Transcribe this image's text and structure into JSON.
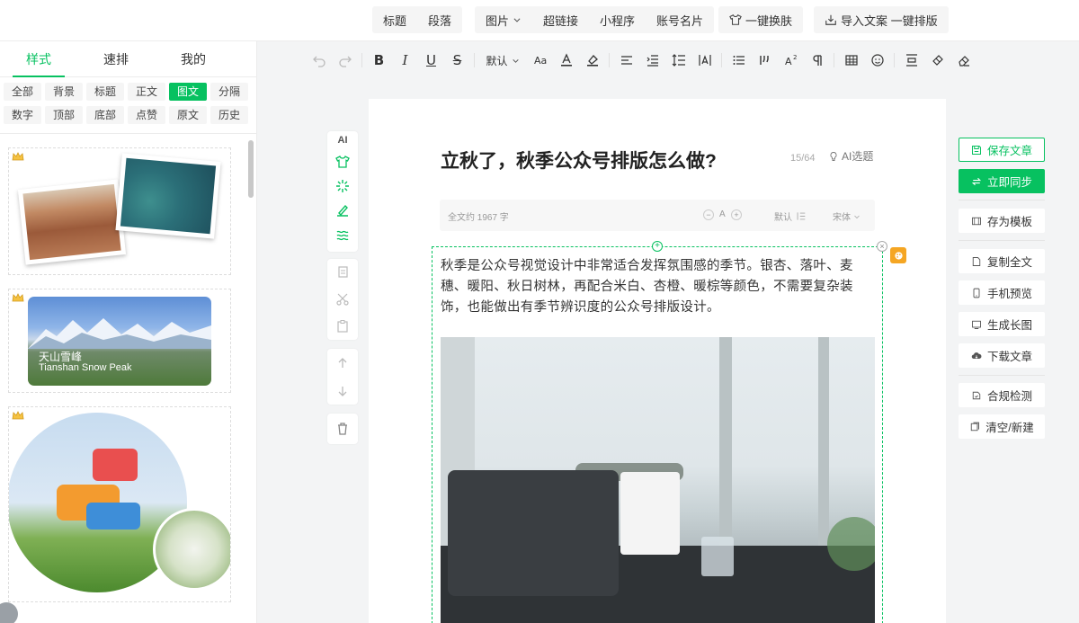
{
  "topbar": {
    "insert_items": [
      {
        "label": "标题"
      },
      {
        "label": "段落"
      },
      {
        "label": "图片"
      },
      {
        "label": "超链接"
      },
      {
        "label": "小程序"
      },
      {
        "label": "账号名片"
      }
    ],
    "skin_label": "一键换肤",
    "import_label": "导入文案 一键排版"
  },
  "left_panel": {
    "tabs": [
      "样式",
      "速排",
      "我的"
    ],
    "active_tab": "样式",
    "categories": [
      "全部",
      "背景",
      "标题",
      "正文",
      "图文",
      "分隔",
      "数字",
      "顶部",
      "底部",
      "点赞",
      "原文",
      "历史"
    ],
    "active_category": "图文",
    "templates": [
      {
        "kind": "photo-collage"
      },
      {
        "kind": "banner",
        "caption_cn": "天山雪峰",
        "caption_en": "Tianshan Snow Peak"
      },
      {
        "kind": "circle-photos"
      }
    ]
  },
  "format_toolbar": {
    "font_size_label": "默认"
  },
  "editor": {
    "title": "立秋了，秋季公众号排版怎么做?",
    "title_count": "15/64",
    "ai_title_label": "AI选题",
    "info": {
      "word_count": "全文约 1967 字",
      "font_size_label": "A",
      "line_height_label": "默认",
      "font_family_label": "宋体"
    },
    "paragraph": "秋季是公众号视觉设计中非常适合发挥氛围感的季节。银杏、落叶、麦穗、暖阳、秋日树林，再配合米白、杏橙、暖棕等颜色，不需要复杂装饰，也能做出有季节辨识度的公众号排版设计。",
    "side_tools": {
      "ai_label": "AI"
    }
  },
  "right_panel": {
    "save": "保存文章",
    "sync": "立即同步",
    "save_template": "存为模板",
    "copy_all": "复制全文",
    "mobile_preview": "手机预览",
    "long_image": "生成长图",
    "download": "下载文章",
    "compliance": "合规检测",
    "clear_new": "清空/新建"
  },
  "colors": {
    "accent": "#07c160",
    "badge_orange": "#f5a623"
  }
}
